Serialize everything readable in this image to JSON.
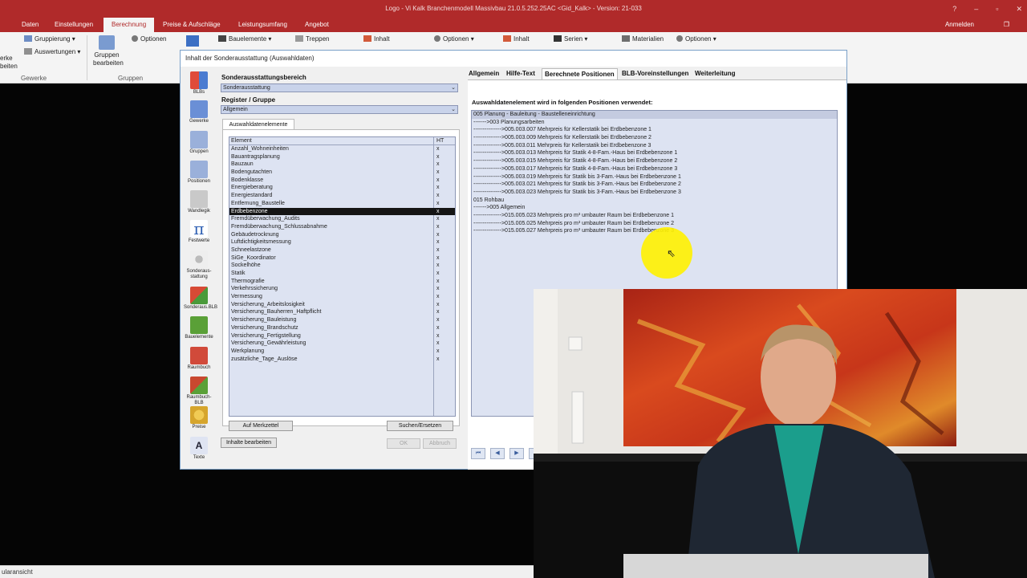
{
  "window": {
    "title": "Logo - Vi Kalk Branchenmodell Massivbau 21.0.5.252.25AC  <Gid_Kalk>  - Version: 21-033",
    "controls": [
      "?",
      "–",
      "▫",
      "✕"
    ]
  },
  "ribbon": {
    "tabs": [
      "Daten",
      "Einstellungen",
      "Berechnung",
      "Preise & Aufschläge",
      "Leistungsumfang",
      "Angebot"
    ],
    "active_tab": "Berechnung",
    "signin": "Anmelden",
    "restore_icon": "restore-icon",
    "items": {
      "left_clip": "erke\nbeiten",
      "gruppierung": "Gruppierung",
      "auswertungen": "Auswertungen",
      "gruppen_bearbeiten": "Gruppen\nbearbeiten",
      "optionen1": "Optionen",
      "bauelemente": "Bauelemente",
      "treppen": "Treppen",
      "inhalt1": "Inhalt",
      "optionen2": "Optionen",
      "inhalt2": "Inhalt",
      "serien": "Serien",
      "materialien": "Materialien",
      "optionen3": "Optionen"
    },
    "group_labels": {
      "gewerke": "Gewerke",
      "gruppen": "Gruppen"
    }
  },
  "statusbar": {
    "text": "ularansicht"
  },
  "dialog": {
    "title": "Inhalt der Sonderausstattung (Auswahldaten)",
    "nav": [
      {
        "label": "BLBs",
        "icon": "blbs-icon",
        "color": "#e04b3a"
      },
      {
        "label": "Gewerke",
        "icon": "gewerke-icon",
        "color": "#6a8fd6"
      },
      {
        "label": "Gruppen",
        "icon": "gruppen-icon",
        "color": "#9ab0da"
      },
      {
        "label": "Positionen",
        "icon": "positionen-icon",
        "color": "#9ab0da"
      },
      {
        "label": "Wandlegik",
        "icon": "wandlogik-icon",
        "color": "#c9c9c9"
      },
      {
        "label": "Festwerte",
        "icon": "pi-icon",
        "color": "#2d5fb3"
      },
      {
        "label": "Sonderaus-\nstattung",
        "icon": "sonderausstattung-icon",
        "color": "#cfcfcf"
      },
      {
        "label": "Sonderaus.BLB",
        "icon": "sonderaus-blb-icon",
        "color": "#d74a35"
      },
      {
        "label": "Bauelemente",
        "icon": "bauelemente-icon",
        "color": "#5aa037"
      },
      {
        "label": "Raumbuch",
        "icon": "raumbuch-icon",
        "color": "#d14a3a"
      },
      {
        "label": "Raumbuch-BLB",
        "icon": "raumbuch-blb-icon",
        "color": "#c9482f"
      },
      {
        "label": "Preise",
        "icon": "preise-icon",
        "color": "#e2b63c"
      },
      {
        "label": "Texte",
        "icon": "texte-icon",
        "color": "#dfe4f2"
      }
    ],
    "left": {
      "bereich_label": "Sonderausstattungsbereich",
      "bereich_value": "Sonderausstattung",
      "register_label": "Register / Gruppe",
      "register_value": "Allgemein",
      "subtab": "Auswahldatenelemente",
      "col_element": "Element",
      "col_ht": "HT",
      "rows": [
        {
          "name": "Anzahl_Wohneinheiten",
          "ht": "x"
        },
        {
          "name": "Bauantragsplanung",
          "ht": "x"
        },
        {
          "name": "Bauzaun",
          "ht": "x"
        },
        {
          "name": "Bodengutachten",
          "ht": "x"
        },
        {
          "name": "Bodenklasse",
          "ht": "x"
        },
        {
          "name": "Energieberatung",
          "ht": "x"
        },
        {
          "name": "Energiestandard",
          "ht": "x"
        },
        {
          "name": "Entfernung_Baustelle",
          "ht": "x"
        },
        {
          "name": "Erdbebenzone",
          "ht": "x"
        },
        {
          "name": "Fremdüberwachung_Audits",
          "ht": "x"
        },
        {
          "name": "Fremdüberwachung_Schlussabnahme",
          "ht": "x"
        },
        {
          "name": "Gebäudetrocknung",
          "ht": "x"
        },
        {
          "name": "Luftdichtigkeitsmessung",
          "ht": "x"
        },
        {
          "name": "Schneelastzone",
          "ht": "x"
        },
        {
          "name": "SiGe_Koordinator",
          "ht": "x"
        },
        {
          "name": "Sockelhöhe",
          "ht": "x"
        },
        {
          "name": "Statik",
          "ht": "x"
        },
        {
          "name": "Thermografie",
          "ht": "x"
        },
        {
          "name": "Verkehrssicherung",
          "ht": "x"
        },
        {
          "name": "Vermessung",
          "ht": "x"
        },
        {
          "name": "Versicherung_Arbeitslosigkeit",
          "ht": "x"
        },
        {
          "name": "Versicherung_Bauherren_Haftpflicht",
          "ht": "x"
        },
        {
          "name": "Versicherung_Bauleistung",
          "ht": "x"
        },
        {
          "name": "Versicherung_Brandschutz",
          "ht": "x"
        },
        {
          "name": "Versicherung_Fertigstellung",
          "ht": "x"
        },
        {
          "name": "Versicherung_Gewährleistung",
          "ht": "x"
        },
        {
          "name": "Werkplanung",
          "ht": "x"
        },
        {
          "name": "zusätzliche_Tage_Auslöse",
          "ht": "x"
        }
      ],
      "selected_index": 8,
      "btn_merkzettel": "Auf Merkzettel",
      "btn_suchen": "Suchen/Ersetzen",
      "btn_inhalte": "Inhalte bearbeiten",
      "btn_ok": "OK",
      "btn_abbruch": "Abbruch"
    },
    "right": {
      "tabs": [
        "Allgemein",
        "Hilfe-Text",
        "Berechnete Positionen",
        "BLB-Voreinstellungen",
        "Weiterleitung"
      ],
      "active_tab": "Berechnete Positionen",
      "heading": "Auswahldatenelement wird in folgenden Positionen verwendet:",
      "lines": [
        "005 Planung - Bauleitung - Baustelleneinrichtung",
        "------->003 Planungsarbeiten",
        "--------------->005.003.007 Mehrpreis für Kellerstatik bei Erdbebenzone 1",
        "--------------->005.003.009 Mehrpreis für Kellerstatik bei Erdbebenzone 2",
        "--------------->005.003.011 Mehrpreis für Kellerstatik bei Erdbebenzone 3",
        "--------------->005.003.013 Mehrpreis für Statik 4-8-Fam.-Haus bei Erdbebenzone 1",
        "--------------->005.003.015 Mehrpreis für Statik 4-8-Fam.-Haus bei Erdbebenzone 2",
        "--------------->005.003.017 Mehrpreis für Statik 4-8-Fam.-Haus bei Erdbebenzone 3",
        "--------------->005.003.019 Mehrpreis für Statik bis 3-Fam.-Haus bei Erdbebenzone 1",
        "--------------->005.003.021 Mehrpreis für Statik bis 3-Fam.-Haus bei Erdbebenzone 2",
        "--------------->005.003.023 Mehrpreis für Statik bis 3-Fam.-Haus bei Erdbebenzone 3",
        "015 Rohbau",
        "------->005 Allgemein",
        "--------------->015.005.023 Mehrpreis pro m³ umbauter Raum bei Erdbebenzone 1",
        "--------------->015.005.025 Mehrpreis pro m³ umbauter Raum bei Erdbebenzone 2",
        "--------------->015.005.027 Mehrpreis pro m³ umbauter Raum bei Erdbebenzone 3"
      ],
      "nav": [
        "⏮",
        "◀",
        "▶",
        "⏭"
      ]
    }
  }
}
